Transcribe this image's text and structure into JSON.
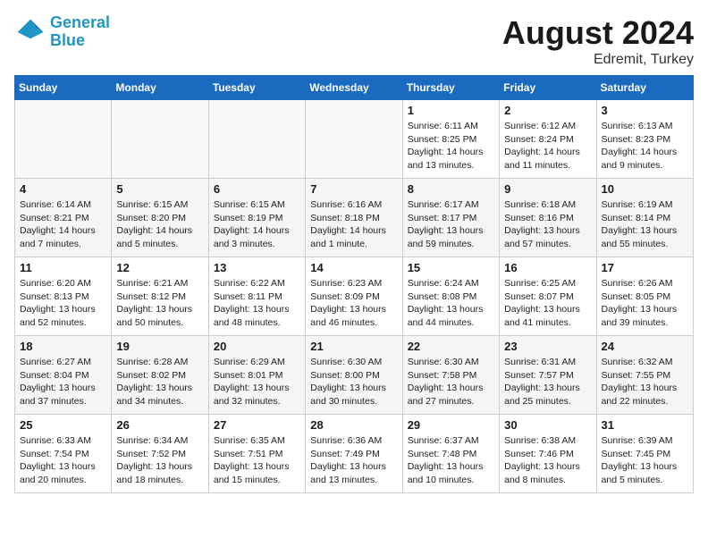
{
  "header": {
    "logo_line1": "General",
    "logo_line2": "Blue",
    "month_year": "August 2024",
    "location": "Edremit, Turkey"
  },
  "weekdays": [
    "Sunday",
    "Monday",
    "Tuesday",
    "Wednesday",
    "Thursday",
    "Friday",
    "Saturday"
  ],
  "weeks": [
    [
      {
        "day": "",
        "info": ""
      },
      {
        "day": "",
        "info": ""
      },
      {
        "day": "",
        "info": ""
      },
      {
        "day": "",
        "info": ""
      },
      {
        "day": "1",
        "info": "Sunrise: 6:11 AM\nSunset: 8:25 PM\nDaylight: 14 hours\nand 13 minutes."
      },
      {
        "day": "2",
        "info": "Sunrise: 6:12 AM\nSunset: 8:24 PM\nDaylight: 14 hours\nand 11 minutes."
      },
      {
        "day": "3",
        "info": "Sunrise: 6:13 AM\nSunset: 8:23 PM\nDaylight: 14 hours\nand 9 minutes."
      }
    ],
    [
      {
        "day": "4",
        "info": "Sunrise: 6:14 AM\nSunset: 8:21 PM\nDaylight: 14 hours\nand 7 minutes."
      },
      {
        "day": "5",
        "info": "Sunrise: 6:15 AM\nSunset: 8:20 PM\nDaylight: 14 hours\nand 5 minutes."
      },
      {
        "day": "6",
        "info": "Sunrise: 6:15 AM\nSunset: 8:19 PM\nDaylight: 14 hours\nand 3 minutes."
      },
      {
        "day": "7",
        "info": "Sunrise: 6:16 AM\nSunset: 8:18 PM\nDaylight: 14 hours\nand 1 minute."
      },
      {
        "day": "8",
        "info": "Sunrise: 6:17 AM\nSunset: 8:17 PM\nDaylight: 13 hours\nand 59 minutes."
      },
      {
        "day": "9",
        "info": "Sunrise: 6:18 AM\nSunset: 8:16 PM\nDaylight: 13 hours\nand 57 minutes."
      },
      {
        "day": "10",
        "info": "Sunrise: 6:19 AM\nSunset: 8:14 PM\nDaylight: 13 hours\nand 55 minutes."
      }
    ],
    [
      {
        "day": "11",
        "info": "Sunrise: 6:20 AM\nSunset: 8:13 PM\nDaylight: 13 hours\nand 52 minutes."
      },
      {
        "day": "12",
        "info": "Sunrise: 6:21 AM\nSunset: 8:12 PM\nDaylight: 13 hours\nand 50 minutes."
      },
      {
        "day": "13",
        "info": "Sunrise: 6:22 AM\nSunset: 8:11 PM\nDaylight: 13 hours\nand 48 minutes."
      },
      {
        "day": "14",
        "info": "Sunrise: 6:23 AM\nSunset: 8:09 PM\nDaylight: 13 hours\nand 46 minutes."
      },
      {
        "day": "15",
        "info": "Sunrise: 6:24 AM\nSunset: 8:08 PM\nDaylight: 13 hours\nand 44 minutes."
      },
      {
        "day": "16",
        "info": "Sunrise: 6:25 AM\nSunset: 8:07 PM\nDaylight: 13 hours\nand 41 minutes."
      },
      {
        "day": "17",
        "info": "Sunrise: 6:26 AM\nSunset: 8:05 PM\nDaylight: 13 hours\nand 39 minutes."
      }
    ],
    [
      {
        "day": "18",
        "info": "Sunrise: 6:27 AM\nSunset: 8:04 PM\nDaylight: 13 hours\nand 37 minutes."
      },
      {
        "day": "19",
        "info": "Sunrise: 6:28 AM\nSunset: 8:02 PM\nDaylight: 13 hours\nand 34 minutes."
      },
      {
        "day": "20",
        "info": "Sunrise: 6:29 AM\nSunset: 8:01 PM\nDaylight: 13 hours\nand 32 minutes."
      },
      {
        "day": "21",
        "info": "Sunrise: 6:30 AM\nSunset: 8:00 PM\nDaylight: 13 hours\nand 30 minutes."
      },
      {
        "day": "22",
        "info": "Sunrise: 6:30 AM\nSunset: 7:58 PM\nDaylight: 13 hours\nand 27 minutes."
      },
      {
        "day": "23",
        "info": "Sunrise: 6:31 AM\nSunset: 7:57 PM\nDaylight: 13 hours\nand 25 minutes."
      },
      {
        "day": "24",
        "info": "Sunrise: 6:32 AM\nSunset: 7:55 PM\nDaylight: 13 hours\nand 22 minutes."
      }
    ],
    [
      {
        "day": "25",
        "info": "Sunrise: 6:33 AM\nSunset: 7:54 PM\nDaylight: 13 hours\nand 20 minutes."
      },
      {
        "day": "26",
        "info": "Sunrise: 6:34 AM\nSunset: 7:52 PM\nDaylight: 13 hours\nand 18 minutes."
      },
      {
        "day": "27",
        "info": "Sunrise: 6:35 AM\nSunset: 7:51 PM\nDaylight: 13 hours\nand 15 minutes."
      },
      {
        "day": "28",
        "info": "Sunrise: 6:36 AM\nSunset: 7:49 PM\nDaylight: 13 hours\nand 13 minutes."
      },
      {
        "day": "29",
        "info": "Sunrise: 6:37 AM\nSunset: 7:48 PM\nDaylight: 13 hours\nand 10 minutes."
      },
      {
        "day": "30",
        "info": "Sunrise: 6:38 AM\nSunset: 7:46 PM\nDaylight: 13 hours\nand 8 minutes."
      },
      {
        "day": "31",
        "info": "Sunrise: 6:39 AM\nSunset: 7:45 PM\nDaylight: 13 hours\nand 5 minutes."
      }
    ]
  ]
}
